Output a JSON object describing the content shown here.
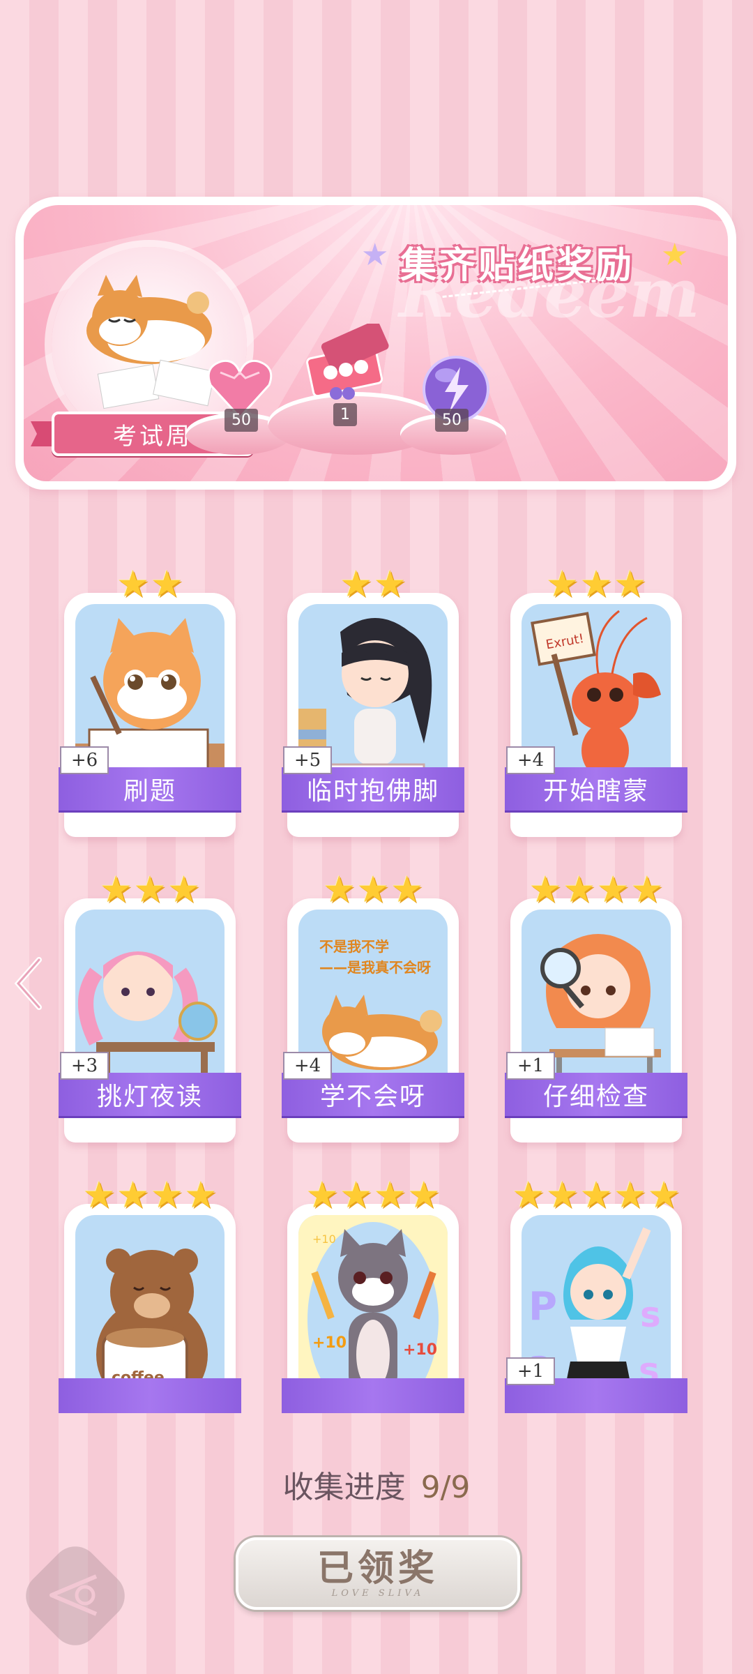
{
  "banner": {
    "title": "集齐贴纸奖励",
    "watermark": "Redeem",
    "theme_label": "考试周",
    "rewards": [
      {
        "icon": "pink-diamond-heart-icon",
        "count": "50"
      },
      {
        "icon": "gift-box-icon",
        "count": "1"
      },
      {
        "icon": "lightning-orb-icon",
        "count": "50"
      }
    ]
  },
  "stickers": [
    {
      "label": "刷题",
      "plus": "+6",
      "stars": 2,
      "art": "cat-writing"
    },
    {
      "label": "临时抱佛脚",
      "plus": "+5",
      "stars": 2,
      "art": "girl-reading"
    },
    {
      "label": "开始瞎蒙",
      "plus": "+4",
      "stars": 3,
      "art": "shrimp-sign",
      "sign_text": "Exrut!"
    },
    {
      "label": "挑灯夜读",
      "plus": "+3",
      "stars": 3,
      "art": "pink-girl-desk"
    },
    {
      "label": "学不会呀",
      "plus": "+4",
      "stars": 3,
      "art": "shiba-sleeping",
      "art_text": "不是我不学——是我真不会呀"
    },
    {
      "label": "仔细检查",
      "plus": "+1",
      "stars": 4,
      "art": "girl-magnifier"
    },
    {
      "label": "",
      "plus": "",
      "stars": 4,
      "art": "bear-coffee",
      "art_text": "coffee"
    },
    {
      "label": "",
      "plus": "",
      "stars": 4,
      "art": "cat-pencils",
      "art_text": "+10"
    },
    {
      "label": "",
      "plus": "+1",
      "stars": 5,
      "art": "girl-letters"
    }
  ],
  "progress": {
    "label": "收集进度",
    "value": "9/9"
  },
  "claim_button": {
    "label": "已领奖",
    "sub": "LOVE SLIVA"
  },
  "colors": {
    "accent_pink": "#e6658a",
    "label_purple": "#9b6be8",
    "star_gold": "#ffcc33"
  }
}
